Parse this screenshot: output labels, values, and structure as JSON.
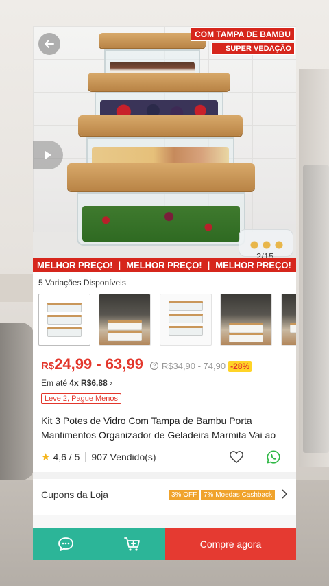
{
  "hero": {
    "badge_line1": "COM TAMPA DE BAMBU",
    "badge_line2": "SUPER VEDAÇÃO",
    "image_counter": "2/15",
    "price_strip": [
      "MELHOR PREÇO!",
      "MELHOR PREÇO!",
      "MELHOR PREÇO!"
    ],
    "strip_separator": "|"
  },
  "variations": {
    "label": "5 Variações Disponíveis",
    "count": 5
  },
  "price": {
    "currency": "R$",
    "range": "24,99 - 63,99",
    "old": "R$34,90 - 74,90",
    "discount": "-28%",
    "help_glyph": "?"
  },
  "installments": {
    "prefix": "Em até ",
    "value": "4x R$6,88",
    "suffix": " ›"
  },
  "promo_tag": "Leve 2, Pague Menos",
  "product": {
    "title": "Kit 3 Potes de Vidro Com Tampa de Bambu Porta Mantimentos Organizador de Geladeira Marmita Vai ao"
  },
  "rating": {
    "score": "4,6 / 5",
    "sold": "907 Vendido(s)",
    "star_glyph": "★"
  },
  "coupons": {
    "label": "Cupons da Loja",
    "tag1": "3% OFF",
    "tag2": "7% Moedas Cashback"
  },
  "actions": {
    "buy_label": "Compre agora"
  },
  "colors": {
    "brand_red": "#e53a31",
    "teal": "#2cb598",
    "promo_yellow": "#ffd428",
    "coupon_orange": "#f0a32c"
  },
  "icons": [
    "back-arrow-icon",
    "play-icon",
    "help-icon",
    "star-icon",
    "heart-icon",
    "whatsapp-icon",
    "chevron-right-icon",
    "chat-icon",
    "add-to-cart-icon"
  ]
}
